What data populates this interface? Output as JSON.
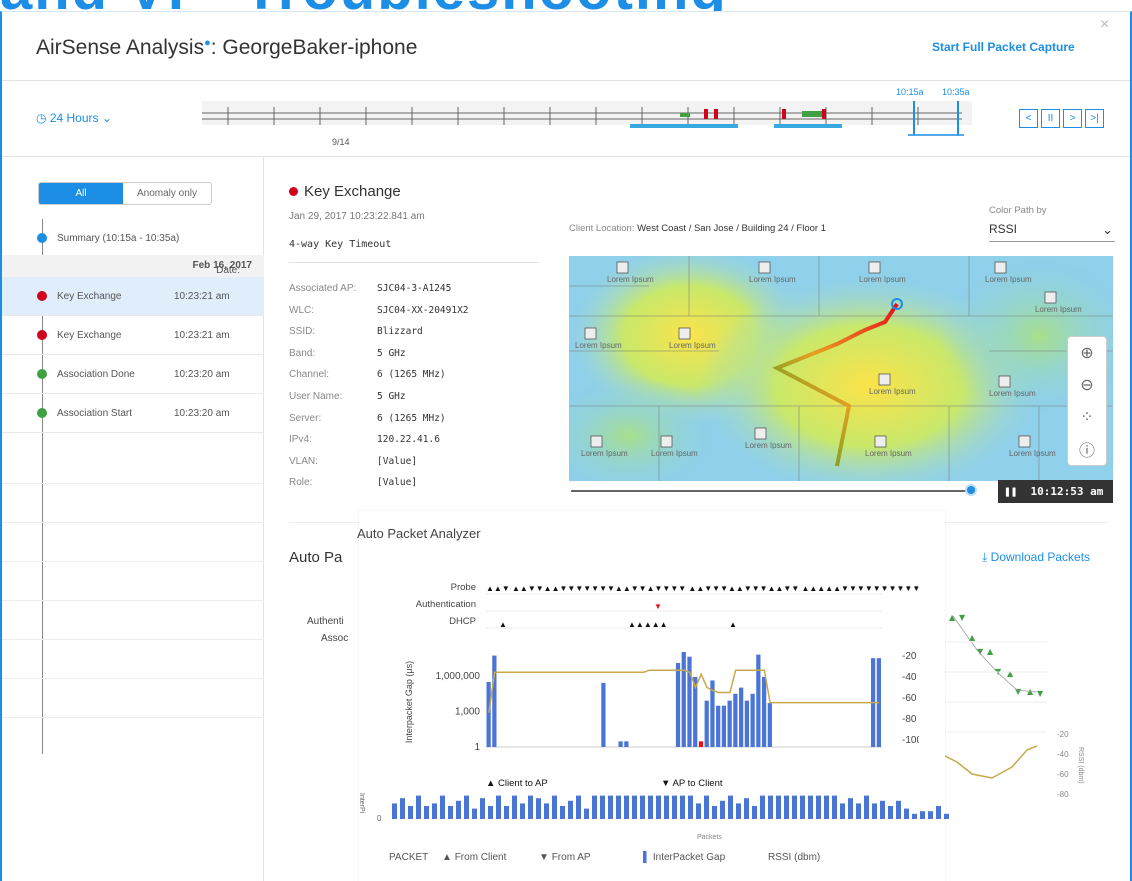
{
  "banner_text": "and VI - Troubleshooting",
  "header": {
    "title": "AirSense Analysis",
    "title_suffix": ": GeorgeBaker-iphone",
    "info_mark": "●",
    "close": "×",
    "start_capture": "Start Full Packet Capture"
  },
  "timeline": {
    "range": "24 Hours",
    "day_label": "9/14",
    "start_time": "10:15a",
    "end_time": "10:35a",
    "playback": [
      "<",
      "II",
      ">",
      ">|"
    ]
  },
  "sidebar": {
    "filter_all": "All",
    "filter_anomaly": "Anomaly only",
    "summary": "Summary (10:15a - 10:35a)",
    "date_prefix": "Date:",
    "date_value": "Feb 16, 2017",
    "events": [
      {
        "label": "Key Exchange",
        "time": "10:23:21 am",
        "status": "error",
        "color": "#d0021b",
        "selected": true
      },
      {
        "label": "Key Exchange",
        "time": "10:23:21 am",
        "status": "error",
        "color": "#d0021b",
        "selected": false
      },
      {
        "label": "Association Done",
        "time": "10:23:20 am",
        "status": "ok",
        "color": "#3fa142",
        "selected": false
      },
      {
        "label": "Association Start",
        "time": "10:23:20 am",
        "status": "ok",
        "color": "#3fa142",
        "selected": false
      }
    ]
  },
  "event": {
    "title": "Key Exchange",
    "datetime": "Jan 29, 2017 10:23:22.841 am",
    "subtitle": "4-way Key Timeout",
    "details": [
      {
        "key": "Associated AP:",
        "value": "SJC04-3-A1245"
      },
      {
        "key": "WLC:",
        "value": "SJC04-XX-20491X2"
      },
      {
        "key": "SSID:",
        "value": "Blizzard"
      },
      {
        "key": "Band:",
        "value": "5 GHz"
      },
      {
        "key": "Channel:",
        "value": "6 (1265 MHz)"
      },
      {
        "key": "User Name:",
        "value": "5 GHz"
      },
      {
        "key": "Server:",
        "value": "6 (1265 MHz)"
      },
      {
        "key": "IPv4:",
        "value": "120.22.41.6"
      },
      {
        "key": "VLAN:",
        "value": "[Value]"
      },
      {
        "key": "Role:",
        "value": "[Value]"
      }
    ]
  },
  "map": {
    "client_location_label": "Client Location:",
    "client_location": "West Coast / San Jose / Building 24 / Floor 1",
    "color_path_label": "Color Path by",
    "color_path_value": "RSSI",
    "room_label": "Lorem Ipsum",
    "playback_time": "10:12:53 am",
    "tools": [
      "zoom-in",
      "zoom-out",
      "locate",
      "info"
    ]
  },
  "analyzer": {
    "section_title": "Auto Pa",
    "overlay_title": "Auto Packet Analyzer",
    "download": "Download Packets",
    "bg_labels": [
      "Authenti",
      "Assoc"
    ],
    "rows": [
      "Probe",
      "Authentication",
      "DHCP"
    ],
    "y_axis_label": "Interpacket Gap (μs)",
    "y_ticks": [
      "1,000,000",
      "1,000",
      "1"
    ],
    "rssi_axis_label": "RSSI (dbm)",
    "rssi_ticks": [
      "-20",
      "-40",
      "-60",
      "-80",
      "-100"
    ],
    "legend_client": "Client to AP",
    "legend_ap": "AP to Client",
    "bottom_axis_label": "Packets",
    "bottom_y_label": "InterPi",
    "bottom_zero": "0",
    "bottom_rssi_ticks": [
      "-60",
      "-80"
    ],
    "right_rssi_ticks": [
      "-20",
      "-40",
      "-60",
      "-80"
    ],
    "right_rssi_label": "RSSI (dbm)",
    "footer": {
      "packet": "PACKET",
      "from_client": "From Client",
      "from_ap": "From AP",
      "gap": "InterPacket Gap",
      "rssi": "RSSI (dbm)"
    },
    "bar_color": "#4a74d6",
    "error_color": "#e8101b",
    "line_color": "#c8a84a"
  },
  "colors": {
    "accent": "#1c8ee6",
    "error": "#d0021b",
    "ok": "#3fa142"
  },
  "chart_data": {
    "type": "bar",
    "title": "Auto Packet Analyzer",
    "ylabel": "Interpacket Gap (μs)",
    "log_scale": true,
    "gap_values": [
      300000,
      50000000,
      0,
      0,
      0,
      0,
      0,
      0,
      0,
      0,
      0,
      0,
      0,
      0,
      0,
      0,
      0,
      0,
      0,
      0,
      250000,
      0,
      0,
      3,
      3,
      0,
      0,
      0,
      0,
      0,
      0,
      0,
      0,
      12000000,
      100000000,
      40000000,
      800000,
      3,
      8000,
      400000,
      3000,
      3000,
      8000,
      30000,
      100000,
      8000,
      30000,
      60000000,
      800000,
      5000,
      0,
      0,
      0,
      0,
      0,
      0,
      0,
      0,
      0,
      0,
      0,
      0,
      0,
      0,
      0,
      0,
      0,
      30000000,
      30000000
    ],
    "error_index": 37,
    "rssi_ylabel": "RSSI (dbm)",
    "rssi_range": [
      -100,
      -20
    ],
    "rssi_values": [
      -80,
      -40,
      -40,
      -40,
      -40,
      -40,
      -40,
      -40,
      -40,
      -40,
      -40,
      -40,
      -40,
      -40,
      -40,
      -40,
      -40,
      -40,
      -40,
      -40,
      -40,
      -40,
      -40,
      -40,
      -40,
      -40,
      -40,
      -40,
      -38,
      -38,
      -38,
      -38,
      -38,
      -38,
      -38,
      -40,
      -55,
      -42,
      -55,
      -58,
      -60,
      -60,
      -60,
      -38,
      -38,
      -38,
      -38,
      -38,
      -38,
      -70,
      -70,
      -70,
      -70,
      -70,
      -70,
      -70,
      -70,
      -70,
      -70,
      -70,
      -70,
      -70,
      -70,
      -70,
      -70,
      -70,
      -70,
      -70,
      -70
    ],
    "probe_pattern": "▲▲▼ ▲▲▼▼▲▲▼▼▼▼▼▼▼▲▲▼▼▲▼▼▼▼  ▲▲▼▼▼▲▲▼▼▼▲▲▼▼ ▲▲▲▲▲▼▼▼▼▼▼▼▼▼▼▼▼▼▼▼▼▼",
    "dhcp_pattern": "▲",
    "dhcp_burst": "▲▲▲▲▲",
    "bottom_bar_values": [
      6,
      8,
      5,
      9,
      5,
      6,
      9,
      5,
      7,
      9,
      4,
      8,
      5,
      9,
      5,
      9,
      6,
      9,
      8,
      6,
      9,
      5,
      7,
      9,
      4,
      9,
      9,
      9,
      9,
      9,
      9,
      9,
      9,
      9,
      9,
      9,
      9,
      9,
      6,
      9,
      5,
      7,
      9,
      6,
      8,
      5,
      9,
      9,
      9,
      9,
      9,
      9,
      9,
      9,
      9,
      9,
      6,
      8,
      6,
      9,
      6,
      7,
      5,
      7,
      4,
      2,
      3,
      3,
      5,
      2
    ]
  }
}
